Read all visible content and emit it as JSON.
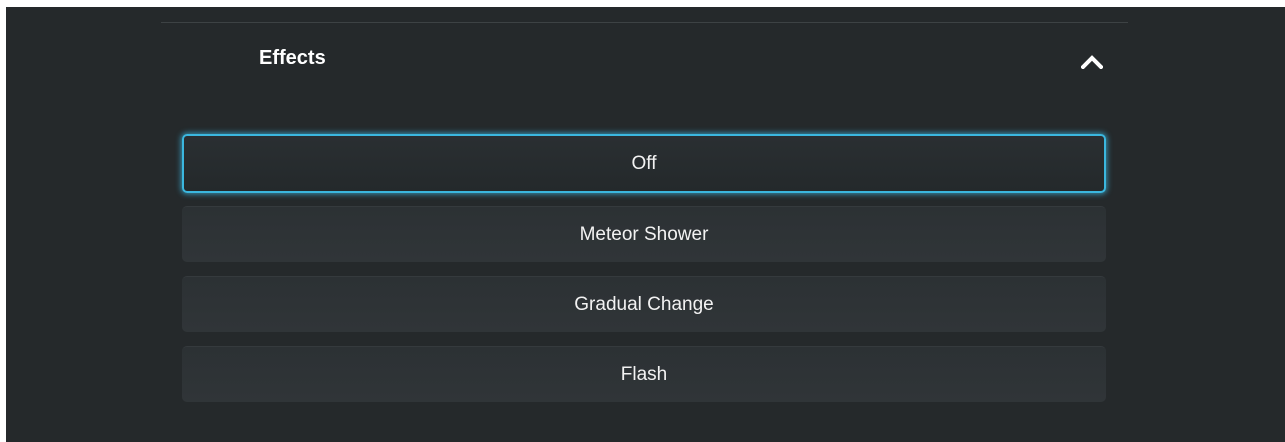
{
  "section": {
    "title": "Effects",
    "toggle_icon": "chevron-up-icon",
    "expanded": true
  },
  "effects": {
    "selected": "Off",
    "options": [
      {
        "label": "Off"
      },
      {
        "label": "Meteor Shower"
      },
      {
        "label": "Gradual Change"
      },
      {
        "label": "Flash"
      }
    ]
  },
  "colors": {
    "background": "#25292b",
    "selected_border": "#3bb7df",
    "text": "#ffffff"
  }
}
